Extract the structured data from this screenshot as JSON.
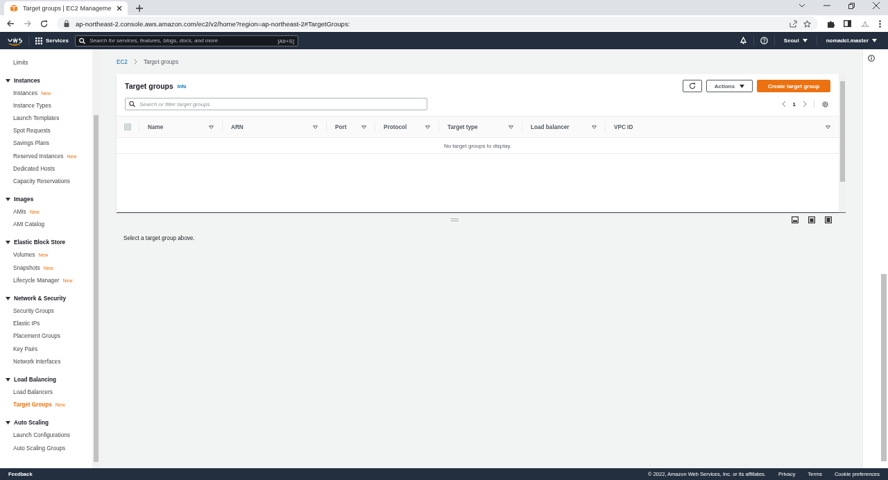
{
  "browser": {
    "tab_title": "Target groups | EC2 Manageme",
    "url": "ap-northeast-2.console.aws.amazon.com/ec2/v2/home?region=ap-northeast-2#TargetGroups:"
  },
  "topnav": {
    "services": "Services",
    "search_placeholder": "Search for services, features, blogs, docs, and more",
    "shortcut": "[Alt+S]",
    "region": "Seoul",
    "account": "nomadcl.master"
  },
  "sidebar": {
    "top_items": [
      {
        "label": "Limits",
        "selected": false
      }
    ],
    "sections": [
      {
        "title": "Instances",
        "expanded": true,
        "items": [
          {
            "label": "Instances",
            "badge": "New",
            "selected": false
          },
          {
            "label": "Instance Types",
            "selected": false
          },
          {
            "label": "Launch Templates",
            "selected": false
          },
          {
            "label": "Spot Requests",
            "selected": false
          },
          {
            "label": "Savings Plans",
            "selected": false
          },
          {
            "label": "Reserved Instances",
            "badge": "New",
            "selected": false
          },
          {
            "label": "Dedicated Hosts",
            "selected": false
          },
          {
            "label": "Capacity Reservations",
            "selected": false
          }
        ]
      },
      {
        "title": "Images",
        "expanded": true,
        "items": [
          {
            "label": "AMIs",
            "badge": "New",
            "selected": false
          },
          {
            "label": "AMI Catalog",
            "selected": false
          }
        ]
      },
      {
        "title": "Elastic Block Store",
        "expanded": true,
        "items": [
          {
            "label": "Volumes",
            "badge": "New",
            "selected": false
          },
          {
            "label": "Snapshots",
            "badge": "New",
            "selected": false
          },
          {
            "label": "Lifecycle Manager",
            "badge": "New",
            "selected": false
          }
        ]
      },
      {
        "title": "Network & Security",
        "expanded": true,
        "items": [
          {
            "label": "Security Groups",
            "selected": false
          },
          {
            "label": "Elastic IPs",
            "selected": false
          },
          {
            "label": "Placement Groups",
            "selected": false
          },
          {
            "label": "Key Pairs",
            "selected": false
          },
          {
            "label": "Network Interfaces",
            "selected": false
          }
        ]
      },
      {
        "title": "Load Balancing",
        "expanded": true,
        "items": [
          {
            "label": "Load Balancers",
            "selected": false
          },
          {
            "label": "Target Groups",
            "badge": "New",
            "selected": true
          }
        ]
      },
      {
        "title": "Auto Scaling",
        "expanded": true,
        "items": [
          {
            "label": "Launch Configurations",
            "selected": false
          },
          {
            "label": "Auto Scaling Groups",
            "selected": false
          }
        ]
      }
    ]
  },
  "breadcrumb": [
    "EC2",
    "Target groups"
  ],
  "panel": {
    "title": "Target groups",
    "info": "Info",
    "actions": "Actions",
    "create": "Create target group",
    "filter_placeholder": "Search or filter target groups",
    "page": "1"
  },
  "table": {
    "select_all_checked": false,
    "columns": [
      "Name",
      "ARN",
      "Port",
      "Protocol",
      "Target type",
      "Load balancer",
      "VPC ID"
    ],
    "empty": "No target groups to display."
  },
  "details": {
    "message": "Select a target group above."
  },
  "footer": {
    "feedback": "Feedback",
    "copyright": "© 2022, Amazon Web Services, Inc. or its affiliates.",
    "links": [
      "Privacy",
      "Terms",
      "Cookie preferences"
    ]
  }
}
